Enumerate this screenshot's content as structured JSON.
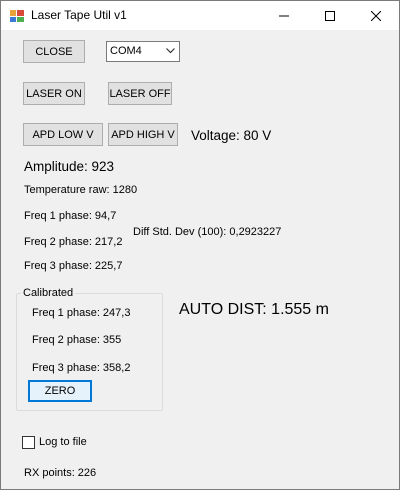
{
  "window": {
    "title": "Laser Tape Util v1"
  },
  "buttons": {
    "close": "CLOSE",
    "laser_on": "LASER ON",
    "laser_off": "LASER OFF",
    "apd_low": "APD LOW V",
    "apd_high": "APD HIGH V",
    "zero": "ZERO"
  },
  "port_select": {
    "value": "COM4"
  },
  "voltage": "Voltage: 80 V",
  "amplitude": "Amplitude: 923",
  "temperature_raw": "Temperature raw: 1280",
  "freq1_phase": "Freq 1 phase: 94,7",
  "freq2_phase": "Freq 2 phase: 217,2",
  "freq3_phase": "Freq 3 phase: 225,7",
  "diff_std_dev": "Diff Std. Dev (100): 0,2923227",
  "calibrated": {
    "title": "Calibrated",
    "freq1": "Freq 1 phase: 247,3",
    "freq2": "Freq 2 phase: 355",
    "freq3": "Freq 3 phase: 358,2"
  },
  "auto_dist": "AUTO DIST: 1.555 m",
  "log_to_file": {
    "label": "Log to file",
    "checked": false
  },
  "rx_points": "RX points: 226",
  "icons": {
    "app": "laser-tape-app-icon",
    "minimize": "minimize-icon",
    "maximize": "maximize-icon",
    "close": "close-icon",
    "dropdown": "chevron-down-icon"
  }
}
